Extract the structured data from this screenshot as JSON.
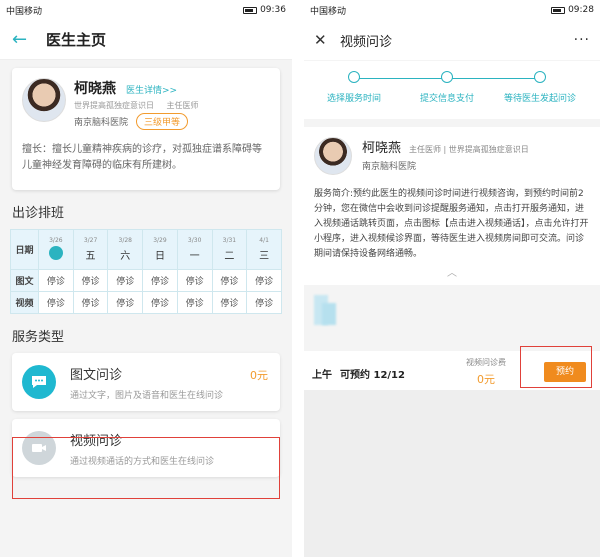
{
  "status_left": {
    "carrier": "中国移动",
    "time": "09:36"
  },
  "status_right": {
    "carrier": "中国移动",
    "time": "09:28"
  },
  "left": {
    "header": {
      "title": "医生主页"
    },
    "doctor": {
      "name": "柯晓燕",
      "detail_link": "医生详情>>",
      "honor": "世界提高孤独症意识日",
      "title": "主任医师",
      "hospital": "南京脑科医院",
      "grade": "三级甲等",
      "specialty": "擅长：擅长儿童精神疾病的诊疗，对孤独症谱系障碍等儿童神经发育障碍的临床有所建树。"
    },
    "schedule_title": "出诊排班",
    "schedule": {
      "row_date_label": "日期",
      "dates": [
        {
          "date": "3/26",
          "weekday": ""
        },
        {
          "date": "3/27",
          "weekday": "五"
        },
        {
          "date": "3/28",
          "weekday": "六"
        },
        {
          "date": "3/29",
          "weekday": "日"
        },
        {
          "date": "3/30",
          "weekday": "一"
        },
        {
          "date": "3/31",
          "weekday": "二"
        },
        {
          "date": "4/1",
          "weekday": "三"
        }
      ],
      "rows": [
        {
          "label": "图文",
          "cells": [
            "停诊",
            "停诊",
            "停诊",
            "停诊",
            "停诊",
            "停诊",
            "停诊"
          ]
        },
        {
          "label": "视频",
          "cells": [
            "停诊",
            "停诊",
            "停诊",
            "停诊",
            "停诊",
            "停诊",
            "停诊"
          ]
        }
      ]
    },
    "service_title": "服务类型",
    "services": [
      {
        "title": "图文问诊",
        "desc": "通过文字，图片及语音和医生在线问诊",
        "price": "0元"
      },
      {
        "title": "视频问诊",
        "desc": "通过视频通话的方式和医生在线问诊",
        "price": ""
      }
    ]
  },
  "right": {
    "header": {
      "title": "视频问诊",
      "more": "···"
    },
    "steps": [
      "选择服务时间",
      "提交信息支付",
      "等待医生发起问诊"
    ],
    "doctor": {
      "name": "柯晓燕",
      "title_line": "主任医师 | 世界提高孤独症意识日",
      "hospital": "南京脑科医院"
    },
    "intro": "服务简介:预约此医生的视频问诊时间进行视频咨询，到预约时间前2分钟，您在微信中会收到问诊提醒服务通知，点击打开服务通知，进入视频通话跳转页面，点击图标【点击进入视频通话】，点击允许打开小程序，进入视频候诊界面，等待医生进入视频房间即可交流。问诊期间请保持设备网络通畅。",
    "slot": {
      "period": "上午",
      "availability": "可预约 12/12",
      "fee_label": "视频问诊费",
      "fee": "0元",
      "book": "预约"
    }
  },
  "colors": {
    "accent": "#2bb3c0",
    "price": "#f29b2e",
    "highlight": "#e0413a",
    "book_button": "#f08b1e"
  }
}
